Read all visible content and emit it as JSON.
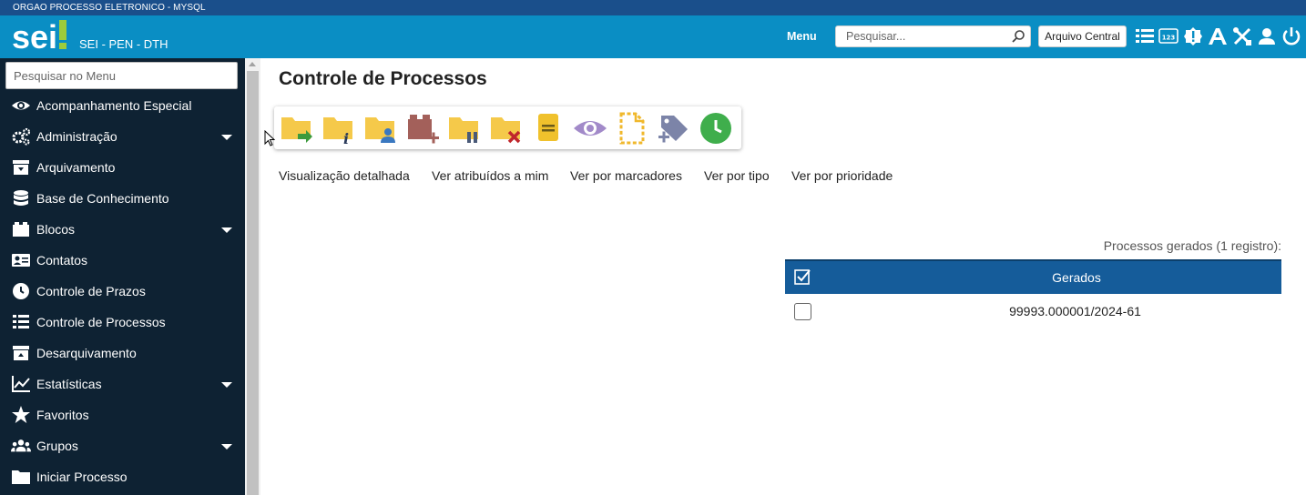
{
  "top_strip": {
    "text": "ORGAO PROCESSO ELETRONICO - MYSQL"
  },
  "header": {
    "logo": "sei!",
    "system_name": "SEI - PEN - DTH",
    "menu_label": "Menu",
    "search_placeholder": "Pesquisar...",
    "arquivo_central_label": "Arquivo Central",
    "icons": [
      "list-icon",
      "numbers-icon",
      "alert-icon",
      "font-size-icon",
      "tools-icon",
      "user-icon",
      "power-icon"
    ]
  },
  "sidebar": {
    "search_placeholder": "Pesquisar no Menu",
    "items": [
      {
        "label": "Acompanhamento Especial",
        "icon": "eye-icon",
        "has_submenu": false
      },
      {
        "label": "Administração",
        "icon": "gears-icon",
        "has_submenu": true
      },
      {
        "label": "Arquivamento",
        "icon": "archive-icon",
        "has_submenu": false
      },
      {
        "label": "Base de Conhecimento",
        "icon": "database-icon",
        "has_submenu": false
      },
      {
        "label": "Blocos",
        "icon": "blocks-icon",
        "has_submenu": true
      },
      {
        "label": "Contatos",
        "icon": "contact-card-icon",
        "has_submenu": false
      },
      {
        "label": "Controle de Prazos",
        "icon": "clock-icon",
        "has_submenu": false
      },
      {
        "label": "Controle de Processos",
        "icon": "list-icon",
        "has_submenu": false
      },
      {
        "label": "Desarquivamento",
        "icon": "unarchive-icon",
        "has_submenu": false
      },
      {
        "label": "Estatísticas",
        "icon": "chart-line-icon",
        "has_submenu": true
      },
      {
        "label": "Favoritos",
        "icon": "star-icon",
        "has_submenu": false
      },
      {
        "label": "Grupos",
        "icon": "users-icon",
        "has_submenu": true
      },
      {
        "label": "Iniciar Processo",
        "icon": "folder-icon",
        "has_submenu": false
      }
    ]
  },
  "main": {
    "title": "Controle de Processos",
    "toolbar_icons": [
      "send-process-icon",
      "process-info-icon",
      "assign-process-icon",
      "add-to-block-icon",
      "sobrestar-process-icon",
      "close-process-icon",
      "annotation-icon",
      "follow-up-icon",
      "new-document-icon",
      "add-marker-icon",
      "deadline-control-icon"
    ],
    "tabs": [
      "Visualização detalhada",
      "Ver atribuídos a mim",
      "Ver por marcadores",
      "Ver por tipo",
      "Ver por prioridade"
    ],
    "table": {
      "caption": "Processos gerados (1 registro):",
      "header": "Gerados",
      "rows": [
        "99993.000001/2024-61"
      ]
    }
  },
  "colors": {
    "strip": "#1a4f8b",
    "header": "#0a8ec4",
    "sidebar": "#0e2233",
    "table_header": "#155c9a",
    "folder": "#f5c94a"
  }
}
